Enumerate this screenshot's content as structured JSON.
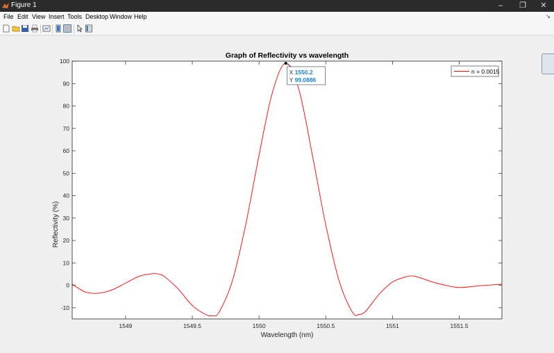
{
  "window": {
    "title": "Figure 1",
    "minimize_glyph": "–",
    "restore_glyph": "❐",
    "close_glyph": "✕"
  },
  "menu": {
    "items": [
      "File",
      "Edit",
      "View",
      "Insert",
      "Tools",
      "Desktop",
      "Window",
      "Help"
    ],
    "expand_glyph": "↘"
  },
  "toolbar": {
    "icons": [
      "new-figure-icon",
      "open-file-icon",
      "save-icon",
      "print-icon",
      "link-plot-icon",
      "colorbar-icon",
      "legend-icon",
      "pointer-icon",
      "property-inspector-icon"
    ]
  },
  "chart_data": {
    "type": "line",
    "title": "Graph of Reflectivity vs wavelength",
    "xlabel": "Wavelength (nm)",
    "ylabel": "Reflectivity (%)",
    "xlim": [
      1548.6,
      1551.82
    ],
    "ylim": [
      -15,
      100
    ],
    "xticks": [
      1549,
      1549.5,
      1550,
      1550.5,
      1551,
      1551.5
    ],
    "xtick_labels": [
      "1549",
      "1549.5",
      "1550",
      "1550.5",
      "1551",
      "1551.5"
    ],
    "yticks": [
      -10,
      0,
      10,
      20,
      30,
      40,
      50,
      60,
      70,
      80,
      90,
      100
    ],
    "ytick_labels": [
      "-10",
      "0",
      "10",
      "20",
      "30",
      "40",
      "50",
      "60",
      "70",
      "80",
      "90",
      "100"
    ],
    "grid": false,
    "legend_position": "top-right",
    "line_color": "#ff0000",
    "series": [
      {
        "name": "n = 0.0015",
        "x": [
          1548.6,
          1548.7,
          1548.8,
          1548.9,
          1549.0,
          1549.1,
          1549.2,
          1549.25,
          1549.3,
          1549.4,
          1549.5,
          1549.6,
          1549.65,
          1549.7,
          1549.8,
          1549.9,
          1550.0,
          1550.1,
          1550.2,
          1550.3,
          1550.4,
          1550.5,
          1550.6,
          1550.7,
          1550.75,
          1550.8,
          1550.9,
          1551.0,
          1551.1,
          1551.15,
          1551.2,
          1551.3,
          1551.4,
          1551.5,
          1551.6,
          1551.7,
          1551.82
        ],
        "y": [
          0.5,
          -3,
          -3.5,
          -2,
          1,
          4,
          5.2,
          5,
          3.5,
          -2,
          -9,
          -13,
          -13.5,
          -12,
          2,
          27,
          58,
          86,
          99.0886,
          87,
          58,
          27,
          2,
          -12,
          -13,
          -11.5,
          -4,
          1.5,
          3.8,
          4.2,
          3.5,
          1.5,
          0,
          -1,
          -0.5,
          0,
          0.5
        ]
      }
    ],
    "datatip": {
      "x_label": "X",
      "x_value": "1550.2",
      "y_label": "Y",
      "y_value": "99.0886",
      "x": 1550.2,
      "y": 99.0886
    }
  }
}
